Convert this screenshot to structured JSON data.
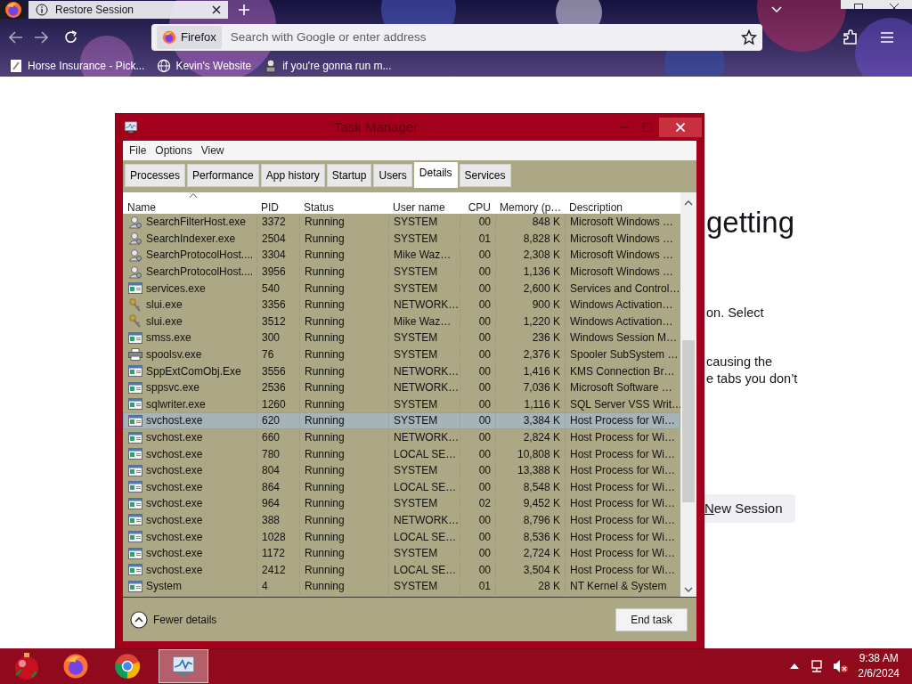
{
  "browser": {
    "tabs": [
      {
        "title": "Restore Session",
        "selected": true
      }
    ],
    "address_bar": {
      "identity": "Firefox",
      "placeholder": "Search with Google or enter address"
    },
    "bookmarks": [
      {
        "label": "Horse Insurance - Pick...",
        "kind": "page"
      },
      {
        "label": "Kevin's Website",
        "kind": "globe"
      },
      {
        "label": "if you're gonna run m...",
        "kind": "figure"
      }
    ]
  },
  "page": {
    "heading": "getting",
    "paragraphs": [
      [
        "on. Select"
      ],
      [
        "causing the",
        "e tabs you don’t"
      ]
    ],
    "new_session_button": "New Session"
  },
  "task_manager": {
    "title": "Task Manager",
    "menu": [
      "File",
      "Options",
      "View"
    ],
    "tabs": [
      {
        "label": "Processes",
        "selected": false
      },
      {
        "label": "Performance",
        "selected": false
      },
      {
        "label": "App history",
        "selected": false
      },
      {
        "label": "Startup",
        "selected": false
      },
      {
        "label": "Users",
        "selected": false
      },
      {
        "label": "Details",
        "selected": true
      },
      {
        "label": "Services",
        "selected": false
      }
    ],
    "columns": [
      {
        "label": "Name",
        "sorted": true
      },
      {
        "label": "PID",
        "sorted": false
      },
      {
        "label": "Status",
        "sorted": false
      },
      {
        "label": "User name",
        "sorted": false
      },
      {
        "label": "CPU",
        "sorted": false
      },
      {
        "label": "Memory (p…",
        "sorted": false
      },
      {
        "label": "Description",
        "sorted": false
      }
    ],
    "rows": [
      {
        "kind": "service",
        "name": "SearchFilterHost.exe",
        "pid": "3372",
        "status": "Running",
        "user": "SYSTEM",
        "cpu": "00",
        "memory": "848 K",
        "description": "Microsoft Windows …",
        "selected": false
      },
      {
        "kind": "service",
        "name": "SearchIndexer.exe",
        "pid": "2504",
        "status": "Running",
        "user": "SYSTEM",
        "cpu": "01",
        "memory": "8,828 K",
        "description": "Microsoft Windows …",
        "selected": false
      },
      {
        "kind": "service",
        "name": "SearchProtocolHost....",
        "pid": "3304",
        "status": "Running",
        "user": "Mike Waz…",
        "cpu": "00",
        "memory": "2,308 K",
        "description": "Microsoft Windows …",
        "selected": false
      },
      {
        "kind": "service",
        "name": "SearchProtocolHost....",
        "pid": "3956",
        "status": "Running",
        "user": "SYSTEM",
        "cpu": "00",
        "memory": "1,136 K",
        "description": "Microsoft Windows …",
        "selected": false
      },
      {
        "kind": "app",
        "name": "services.exe",
        "pid": "540",
        "status": "Running",
        "user": "SYSTEM",
        "cpu": "00",
        "memory": "2,600 K",
        "description": "Services and Control…",
        "selected": false
      },
      {
        "kind": "key",
        "name": "slui.exe",
        "pid": "3356",
        "status": "Running",
        "user": "NETWORK…",
        "cpu": "00",
        "memory": "900 K",
        "description": "Windows Activation…",
        "selected": false
      },
      {
        "kind": "key",
        "name": "slui.exe",
        "pid": "3512",
        "status": "Running",
        "user": "Mike Waz…",
        "cpu": "00",
        "memory": "1,220 K",
        "description": "Windows Activation…",
        "selected": false
      },
      {
        "kind": "app",
        "name": "smss.exe",
        "pid": "300",
        "status": "Running",
        "user": "SYSTEM",
        "cpu": "00",
        "memory": "236 K",
        "description": "Windows Session M…",
        "selected": false
      },
      {
        "kind": "printer",
        "name": "spoolsv.exe",
        "pid": "76",
        "status": "Running",
        "user": "SYSTEM",
        "cpu": "00",
        "memory": "2,376 K",
        "description": "Spooler SubSystem …",
        "selected": false
      },
      {
        "kind": "app",
        "name": "SppExtComObj.Exe",
        "pid": "3556",
        "status": "Running",
        "user": "NETWORK…",
        "cpu": "00",
        "memory": "1,416 K",
        "description": "KMS Connection Br…",
        "selected": false
      },
      {
        "kind": "app",
        "name": "sppsvc.exe",
        "pid": "2536",
        "status": "Running",
        "user": "NETWORK…",
        "cpu": "00",
        "memory": "7,036 K",
        "description": "Microsoft Software …",
        "selected": false
      },
      {
        "kind": "app",
        "name": "sqlwriter.exe",
        "pid": "1260",
        "status": "Running",
        "user": "SYSTEM",
        "cpu": "00",
        "memory": "1,116 K",
        "description": "SQL Server VSS Writ…",
        "selected": false
      },
      {
        "kind": "app",
        "name": "svchost.exe",
        "pid": "620",
        "status": "Running",
        "user": "SYSTEM",
        "cpu": "00",
        "memory": "3,384 K",
        "description": "Host Process for Wi…",
        "selected": true
      },
      {
        "kind": "app",
        "name": "svchost.exe",
        "pid": "660",
        "status": "Running",
        "user": "NETWORK…",
        "cpu": "00",
        "memory": "2,824 K",
        "description": "Host Process for Wi…",
        "selected": false
      },
      {
        "kind": "app",
        "name": "svchost.exe",
        "pid": "780",
        "status": "Running",
        "user": "LOCAL SE…",
        "cpu": "00",
        "memory": "10,808 K",
        "description": "Host Process for Wi…",
        "selected": false
      },
      {
        "kind": "app",
        "name": "svchost.exe",
        "pid": "804",
        "status": "Running",
        "user": "SYSTEM",
        "cpu": "00",
        "memory": "13,388 K",
        "description": "Host Process for Wi…",
        "selected": false
      },
      {
        "kind": "app",
        "name": "svchost.exe",
        "pid": "864",
        "status": "Running",
        "user": "LOCAL SE…",
        "cpu": "00",
        "memory": "8,548 K",
        "description": "Host Process for Wi…",
        "selected": false
      },
      {
        "kind": "app",
        "name": "svchost.exe",
        "pid": "964",
        "status": "Running",
        "user": "SYSTEM",
        "cpu": "02",
        "memory": "9,452 K",
        "description": "Host Process for Wi…",
        "selected": false
      },
      {
        "kind": "app",
        "name": "svchost.exe",
        "pid": "388",
        "status": "Running",
        "user": "NETWORK…",
        "cpu": "00",
        "memory": "8,796 K",
        "description": "Host Process for Wi…",
        "selected": false
      },
      {
        "kind": "app",
        "name": "svchost.exe",
        "pid": "1028",
        "status": "Running",
        "user": "LOCAL SE…",
        "cpu": "00",
        "memory": "8,536 K",
        "description": "Host Process for Wi…",
        "selected": false
      },
      {
        "kind": "app",
        "name": "svchost.exe",
        "pid": "1172",
        "status": "Running",
        "user": "SYSTEM",
        "cpu": "00",
        "memory": "2,724 K",
        "description": "Host Process for Wi…",
        "selected": false
      },
      {
        "kind": "app",
        "name": "svchost.exe",
        "pid": "2412",
        "status": "Running",
        "user": "LOCAL SE…",
        "cpu": "00",
        "memory": "3,504 K",
        "description": "Host Process for Wi…",
        "selected": false
      },
      {
        "kind": "app",
        "name": "System",
        "pid": "4",
        "status": "Running",
        "user": "SYSTEM",
        "cpu": "01",
        "memory": "28 K",
        "description": "NT Kernel & System",
        "selected": false
      }
    ],
    "fewer_details": "Fewer details",
    "end_task": "End task"
  },
  "taskbar": {
    "apps": [
      {
        "kind": "firefox",
        "active": false
      },
      {
        "kind": "chrome",
        "active": false
      },
      {
        "kind": "task-manager",
        "active": true
      }
    ],
    "time": "9:38 AM",
    "date": "2/6/2024"
  }
}
